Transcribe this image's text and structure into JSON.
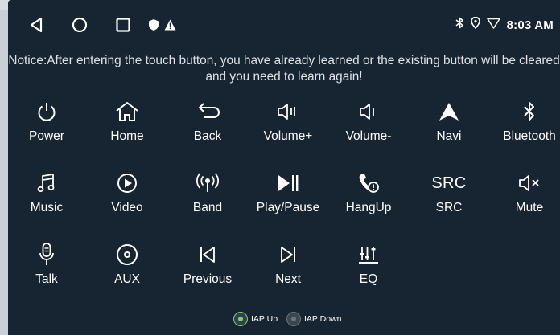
{
  "status": {
    "time": "8:03 AM"
  },
  "notice": "Notice:After entering the touch button, you have already learned or the existing button will be cleared and you need to learn again!",
  "buttons": [
    {
      "label": "Power",
      "icon": "power-icon"
    },
    {
      "label": "Home",
      "icon": "home-icon"
    },
    {
      "label": "Back",
      "icon": "back-icon"
    },
    {
      "label": "Volume+",
      "icon": "volume-up-icon"
    },
    {
      "label": "Volume-",
      "icon": "volume-down-icon"
    },
    {
      "label": "Navi",
      "icon": "navigation-icon"
    },
    {
      "label": "Bluetooth",
      "icon": "bluetooth-icon"
    },
    {
      "label": "Music",
      "icon": "music-icon"
    },
    {
      "label": "Video",
      "icon": "video-icon"
    },
    {
      "label": "Band",
      "icon": "radio-band-icon"
    },
    {
      "label": "Play/Pause",
      "icon": "play-pause-icon"
    },
    {
      "label": "HangUp",
      "icon": "hang-up-icon"
    },
    {
      "label": "SRC",
      "icon": "src-icon",
      "icon_text": "SRC"
    },
    {
      "label": "Mute",
      "icon": "mute-icon"
    },
    {
      "label": "Talk",
      "icon": "microphone-icon"
    },
    {
      "label": "AUX",
      "icon": "aux-icon"
    },
    {
      "label": "Previous",
      "icon": "previous-icon"
    },
    {
      "label": "Next",
      "icon": "next-icon"
    },
    {
      "label": "EQ",
      "icon": "equalizer-icon"
    }
  ],
  "iap": {
    "options": [
      "IAP Up",
      "IAP Down"
    ],
    "selected": "IAP Up"
  },
  "colors": {
    "screen_bg": "#172431",
    "selected_radio": "#7dd36a",
    "unselected_radio": "#6b7580"
  }
}
